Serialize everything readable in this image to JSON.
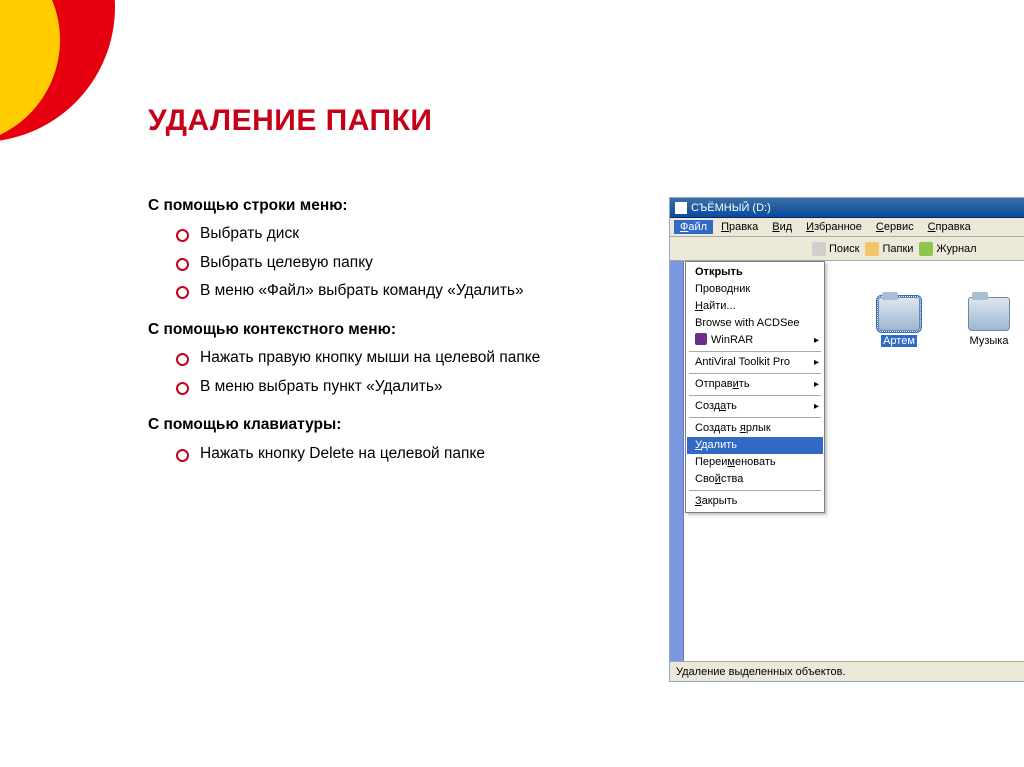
{
  "title": "УДАЛЕНИЕ ПАПКИ",
  "sections": [
    {
      "head": "С помощью строки меню:",
      "bullets": [
        "Выбрать диск",
        "Выбрать целевую папку",
        "В меню «Файл» выбрать команду «Удалить»"
      ]
    },
    {
      "head": "С помощью контекстного меню:",
      "bullets": [
        "Нажать правую кнопку мыши на целевой папке",
        "В меню выбрать пункт «Удалить»"
      ]
    },
    {
      "head": "С помощью клавиатуры:",
      "bullets": [
        "Нажать кнопку Delete на целевой папке"
      ]
    }
  ],
  "explorer": {
    "window_title": "СЪЁМНЫЙ (D:)",
    "menubar": [
      "Файл",
      "Правка",
      "Вид",
      "Избранное",
      "Сервис",
      "Справка"
    ],
    "toolbar": {
      "search": "Поиск",
      "folders": "Папки",
      "journal": "Журнал"
    },
    "context_menu": [
      {
        "label": "Открыть",
        "bold": true
      },
      {
        "label": "Проводник"
      },
      {
        "label": "Найти...",
        "underline": 0
      },
      {
        "label": "Browse with ACDSee"
      },
      {
        "label": "WinRAR",
        "arrow": true,
        "icon": true
      },
      {
        "sep": true
      },
      {
        "label": "AntiViral Toolkit Pro",
        "arrow": true
      },
      {
        "sep": true
      },
      {
        "label": "Отправить",
        "arrow": true,
        "underline": 6
      },
      {
        "sep": true
      },
      {
        "label": "Создать",
        "arrow": true,
        "underline": 4
      },
      {
        "sep": true
      },
      {
        "label": "Создать ярлык",
        "underline_word2": 0
      },
      {
        "label": "Удалить",
        "highlight": true,
        "underline": 0
      },
      {
        "label": "Переименовать",
        "underline": 5
      },
      {
        "label": "Свойства",
        "underline": 3
      },
      {
        "sep": true
      },
      {
        "label": "Закрыть",
        "underline": 0
      }
    ],
    "folders": [
      {
        "name": "Артем",
        "selected": true
      },
      {
        "name": "Музыка",
        "selected": false
      }
    ],
    "statusbar": "Удаление выделенных объектов."
  }
}
